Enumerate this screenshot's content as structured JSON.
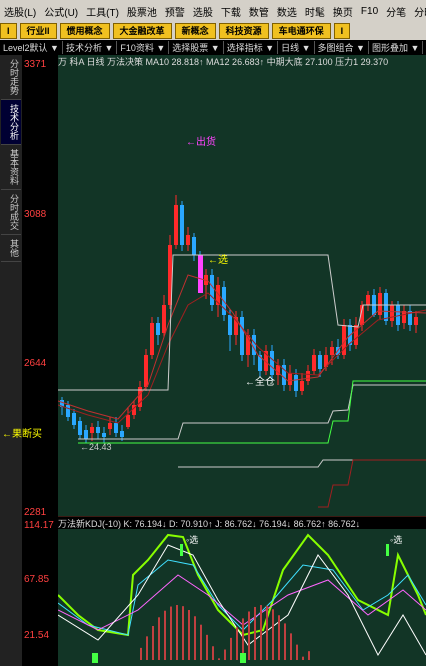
{
  "menu": [
    "选股(L)",
    "公式(U)",
    "工具(T)",
    "股票池",
    "预警",
    "选股",
    "下载",
    "数管",
    "数选",
    "时髦",
    "换页",
    "F10",
    "分笔",
    "分时",
    "1"
  ],
  "toolbar": {
    "left": "I",
    "buttons": [
      "行业II",
      "惯用概念",
      "大金融改革",
      "新概念",
      "科技资源",
      "车电通环保"
    ],
    "right": "I"
  },
  "tabs": [
    "Level2默认",
    "技术分析",
    "F10资料",
    "选择股票",
    "选择指标",
    "日线",
    "多图组合",
    "图形叠加",
    "常用指标"
  ],
  "sidetabs": [
    "分时走势",
    "技术分析",
    "基本资料",
    "分时成交",
    "其他"
  ],
  "active_sidetab": 1,
  "price_axis": [
    "3371",
    "3088",
    "2644",
    "2281"
  ],
  "indicator_axis": [
    "114.17",
    "67.85",
    "21.54"
  ],
  "chart_header": "万 科A 日线 万法决策 MA10 28.818↑ MA12 26.683↑ 中期大底 27.100 压力1 29.370",
  "indicator_header": "万法新KDJ(-10) K: 76.194↓ D: 70.910↑ J: 86.762↓ 76.194↓ 86.762↑ 86.762↓",
  "annotations": {
    "out": "←出货",
    "select": "←选",
    "full": "←全仓",
    "buy": "←果断买",
    "low": "←24.43",
    "ind_select": "◦选"
  },
  "colors": {
    "up": "#ff2a2a",
    "down": "#2aa8ff",
    "bg": "#123526",
    "pink": "#ff44ff",
    "yellow": "#ffff00",
    "green": "#44ff44"
  }
}
